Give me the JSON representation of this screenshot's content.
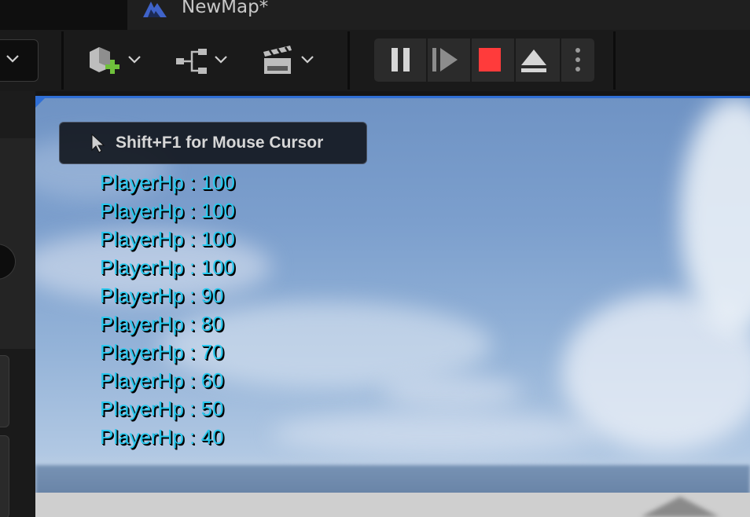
{
  "tab": {
    "title": "NewMap*",
    "icon": "unreal-map-icon"
  },
  "toolbar": {
    "left_dropdown_icon": "chevron-down-icon",
    "quick_add_icon": "add-actor-icon",
    "blueprints_icon": "blueprint-graph-icon",
    "cinematics_icon": "clapperboard-icon",
    "play_controls": {
      "pause_icon": "pause-icon",
      "step_icon": "frame-step-icon",
      "stop_icon": "stop-icon",
      "eject_icon": "eject-icon",
      "more_icon": "kebab-menu-icon",
      "stop_color": "#ff3b3b"
    }
  },
  "viewport": {
    "cursor_hint": "Shift+F1 for Mouse Cursor",
    "accent_color": "#2f6fd6",
    "debug_color": "#28c8ee",
    "debug_messages": [
      "PlayerHp : 100",
      "PlayerHp : 100",
      "PlayerHp : 100",
      "PlayerHp : 100",
      "PlayerHp : 90",
      "PlayerHp : 80",
      "PlayerHp : 70",
      "PlayerHp : 60",
      "PlayerHp : 50",
      "PlayerHp : 40"
    ]
  }
}
